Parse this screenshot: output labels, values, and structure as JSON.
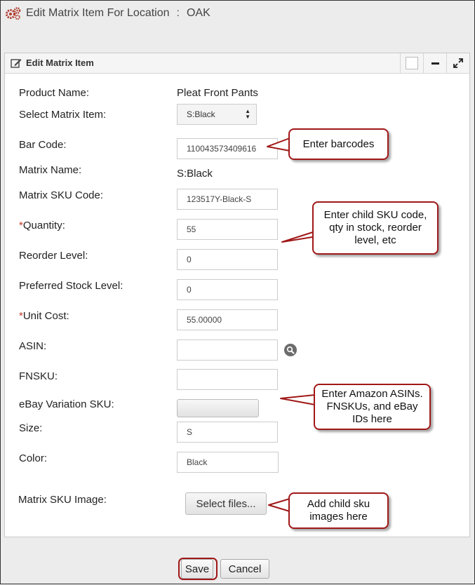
{
  "page": {
    "title": "Edit Matrix Item For Location",
    "separator": ":",
    "location": "OAK"
  },
  "panel": {
    "title": "Edit Matrix Item"
  },
  "form": {
    "product_name_label": "Product Name:",
    "product_name_value": "Pleat Front Pants",
    "select_matrix_label": "Select Matrix Item:",
    "select_matrix_value": "S:Black",
    "bar_code_label": "Bar Code:",
    "bar_code_value": "110043573409616",
    "matrix_name_label": "Matrix Name:",
    "matrix_name_value": "S:Black",
    "matrix_sku_label": "Matrix SKU Code:",
    "matrix_sku_value": "123517Y-Black-S",
    "required_mark": "*",
    "quantity_label": "Quantity:",
    "quantity_value": "55",
    "reorder_label": "Reorder Level:",
    "reorder_value": "0",
    "preferred_label": "Preferred Stock Level:",
    "preferred_value": "0",
    "unit_cost_label": "Unit Cost:",
    "unit_cost_value": "55.00000",
    "asin_label": "ASIN:",
    "asin_value": "",
    "fnsku_label": "FNSKU:",
    "fnsku_value": "",
    "ebay_label": "eBay Variation SKU:",
    "size_label": "Size:",
    "size_value": "S",
    "color_label": "Color:",
    "color_value": "Black",
    "image_label": "Matrix SKU Image:",
    "select_files_label": "Select files..."
  },
  "callouts": {
    "barcodes": "Enter barcodes",
    "child_sku": "Enter child SKU code, qty in stock, reorder level, etc",
    "amazon": "Enter Amazon ASINs. FNSKUs, and eBay IDs here",
    "images": "Add child sku images here"
  },
  "buttons": {
    "save": "Save",
    "cancel": "Cancel"
  },
  "colors": {
    "accent_red": "#a01818",
    "required": "#c0392b",
    "gear": "#b03a2e"
  },
  "icons": {
    "header": "gears-icon",
    "panel": "edit-icon",
    "asin": "search-icon"
  }
}
